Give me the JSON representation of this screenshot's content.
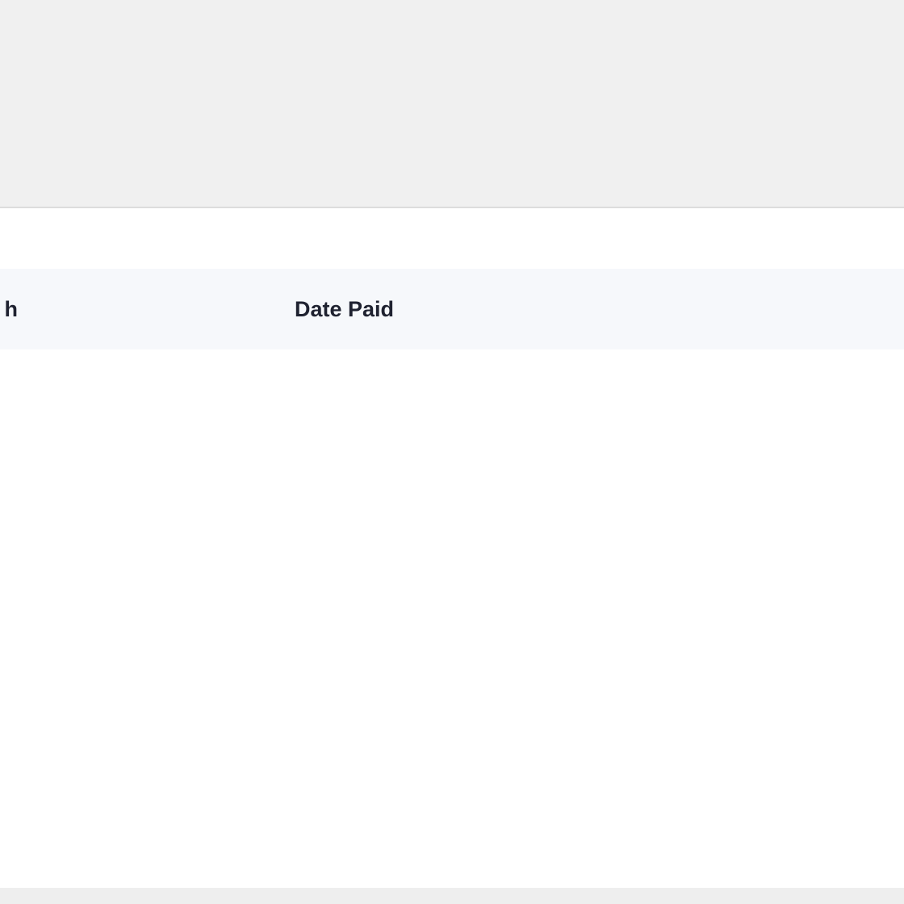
{
  "table": {
    "columns": [
      {
        "label": "h"
      },
      {
        "label": "Date Paid"
      }
    ]
  }
}
